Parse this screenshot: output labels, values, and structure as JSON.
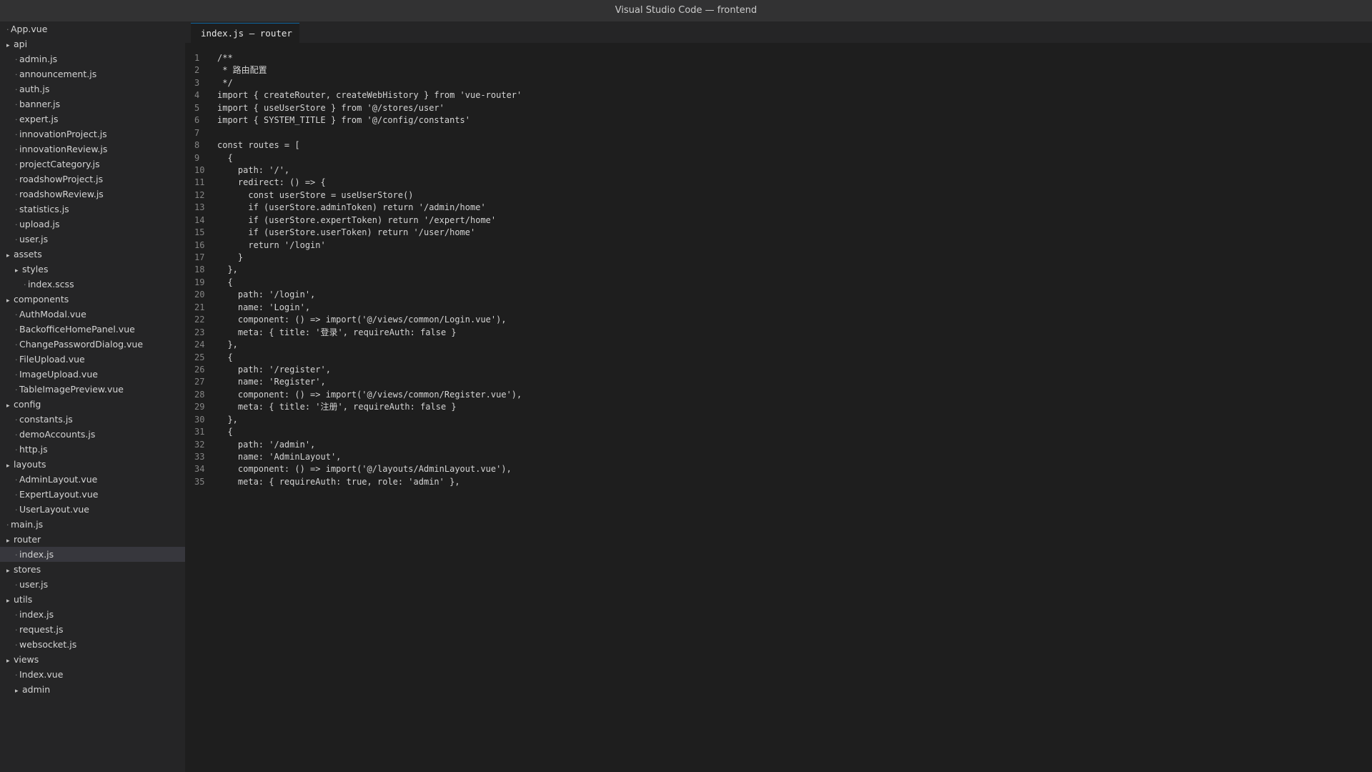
{
  "window": {
    "title": "Visual Studio Code — frontend"
  },
  "tab": {
    "label": "index.js — router"
  },
  "explorer": {
    "items": [
      {
        "label": "App.vue",
        "type": "file",
        "depth": 0
      },
      {
        "label": "api",
        "type": "folder",
        "depth": 0
      },
      {
        "label": "admin.js",
        "type": "file",
        "depth": 1
      },
      {
        "label": "announcement.js",
        "type": "file",
        "depth": 1
      },
      {
        "label": "auth.js",
        "type": "file",
        "depth": 1
      },
      {
        "label": "banner.js",
        "type": "file",
        "depth": 1
      },
      {
        "label": "expert.js",
        "type": "file",
        "depth": 1
      },
      {
        "label": "innovationProject.js",
        "type": "file",
        "depth": 1
      },
      {
        "label": "innovationReview.js",
        "type": "file",
        "depth": 1
      },
      {
        "label": "projectCategory.js",
        "type": "file",
        "depth": 1
      },
      {
        "label": "roadshowProject.js",
        "type": "file",
        "depth": 1
      },
      {
        "label": "roadshowReview.js",
        "type": "file",
        "depth": 1
      },
      {
        "label": "statistics.js",
        "type": "file",
        "depth": 1
      },
      {
        "label": "upload.js",
        "type": "file",
        "depth": 1
      },
      {
        "label": "user.js",
        "type": "file",
        "depth": 1
      },
      {
        "label": "assets",
        "type": "folder",
        "depth": 0
      },
      {
        "label": "styles",
        "type": "folder",
        "depth": 1
      },
      {
        "label": "index.scss",
        "type": "file",
        "depth": 2
      },
      {
        "label": "components",
        "type": "folder",
        "depth": 0
      },
      {
        "label": "AuthModal.vue",
        "type": "file",
        "depth": 1
      },
      {
        "label": "BackofficeHomePanel.vue",
        "type": "file",
        "depth": 1
      },
      {
        "label": "ChangePasswordDialog.vue",
        "type": "file",
        "depth": 1
      },
      {
        "label": "FileUpload.vue",
        "type": "file",
        "depth": 1
      },
      {
        "label": "ImageUpload.vue",
        "type": "file",
        "depth": 1
      },
      {
        "label": "TableImagePreview.vue",
        "type": "file",
        "depth": 1
      },
      {
        "label": "config",
        "type": "folder",
        "depth": 0
      },
      {
        "label": "constants.js",
        "type": "file",
        "depth": 1
      },
      {
        "label": "demoAccounts.js",
        "type": "file",
        "depth": 1
      },
      {
        "label": "http.js",
        "type": "file",
        "depth": 1
      },
      {
        "label": "layouts",
        "type": "folder",
        "depth": 0
      },
      {
        "label": "AdminLayout.vue",
        "type": "file",
        "depth": 1
      },
      {
        "label": "ExpertLayout.vue",
        "type": "file",
        "depth": 1
      },
      {
        "label": "UserLayout.vue",
        "type": "file",
        "depth": 1
      },
      {
        "label": "main.js",
        "type": "file",
        "depth": 0
      },
      {
        "label": "router",
        "type": "folder",
        "depth": 0
      },
      {
        "label": "index.js",
        "type": "file",
        "depth": 1,
        "selected": true
      },
      {
        "label": "stores",
        "type": "folder",
        "depth": 0
      },
      {
        "label": "user.js",
        "type": "file",
        "depth": 1
      },
      {
        "label": "utils",
        "type": "folder",
        "depth": 0
      },
      {
        "label": "index.js",
        "type": "file",
        "depth": 1
      },
      {
        "label": "request.js",
        "type": "file",
        "depth": 1
      },
      {
        "label": "websocket.js",
        "type": "file",
        "depth": 1
      },
      {
        "label": "views",
        "type": "folder",
        "depth": 0
      },
      {
        "label": "Index.vue",
        "type": "file",
        "depth": 1
      },
      {
        "label": "admin",
        "type": "folder",
        "depth": 1
      }
    ]
  },
  "editor": {
    "lines": [
      "/**",
      " * 路由配置",
      " */",
      "import { createRouter, createWebHistory } from 'vue-router'",
      "import { useUserStore } from '@/stores/user'",
      "import { SYSTEM_TITLE } from '@/config/constants'",
      "",
      "const routes = [",
      "  {",
      "    path: '/',",
      "    redirect: () => {",
      "      const userStore = useUserStore()",
      "      if (userStore.adminToken) return '/admin/home'",
      "      if (userStore.expertToken) return '/expert/home'",
      "      if (userStore.userToken) return '/user/home'",
      "      return '/login'",
      "    }",
      "  },",
      "  {",
      "    path: '/login',",
      "    name: 'Login',",
      "    component: () => import('@/views/common/Login.vue'),",
      "    meta: { title: '登录', requireAuth: false }",
      "  },",
      "  {",
      "    path: '/register',",
      "    name: 'Register',",
      "    component: () => import('@/views/common/Register.vue'),",
      "    meta: { title: '注册', requireAuth: false }",
      "  },",
      "  {",
      "    path: '/admin',",
      "    name: 'AdminLayout',",
      "    component: () => import('@/layouts/AdminLayout.vue'),",
      "    meta: { requireAuth: true, role: 'admin' },"
    ]
  },
  "colors": {
    "editor_bg": "#1e1e1e",
    "sidebar_bg": "#252526",
    "titlebar_bg": "#323233",
    "selection_bg": "#37373d",
    "text": "#d4d4d4",
    "line_number": "#858585"
  }
}
